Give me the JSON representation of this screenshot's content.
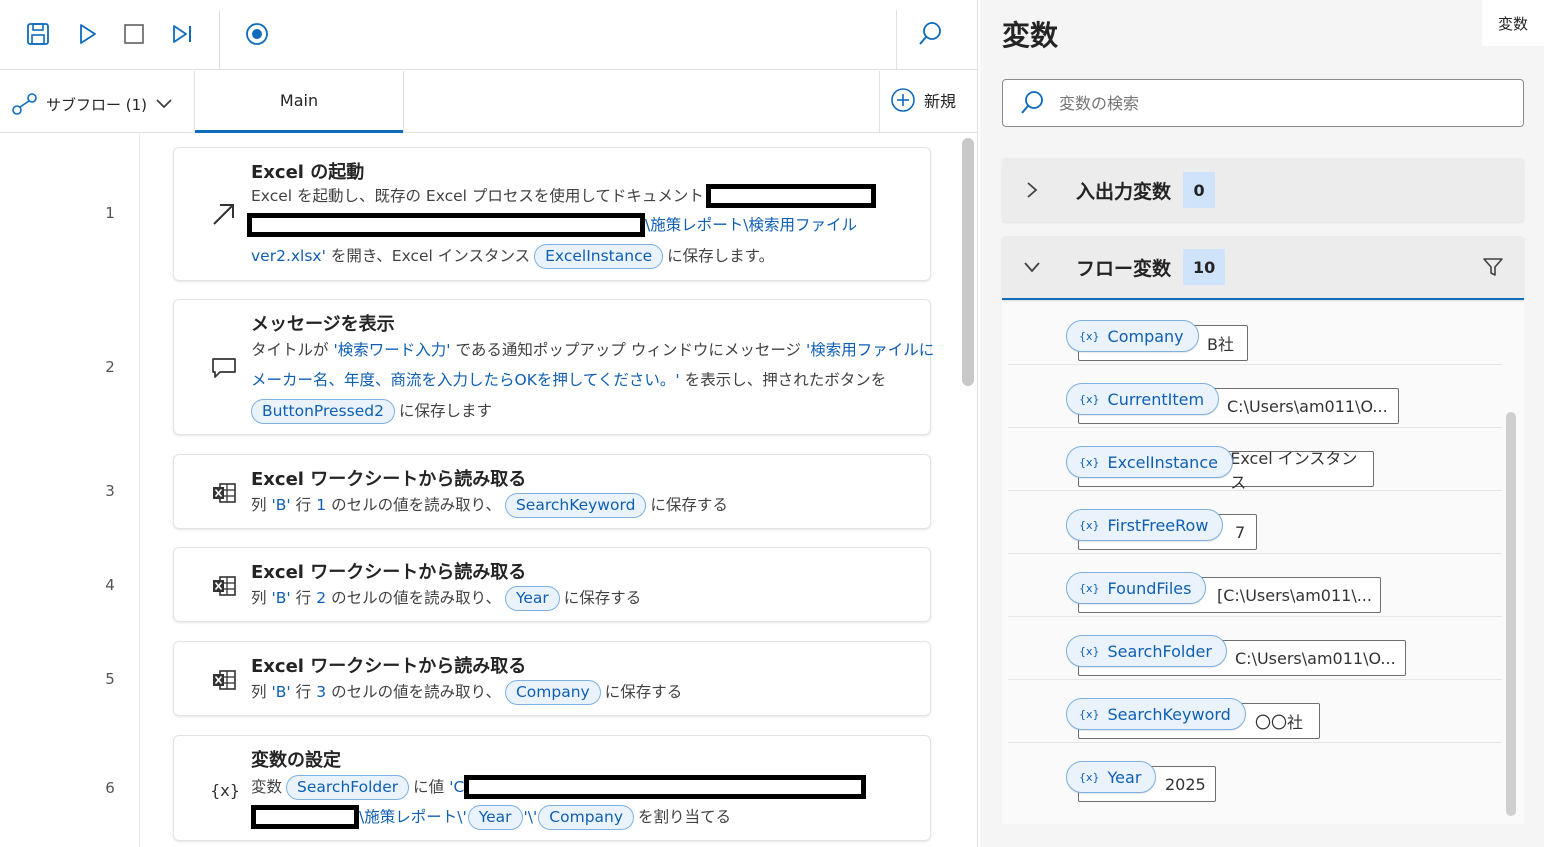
{
  "toolbar": {
    "icons": [
      "save-icon",
      "run-icon",
      "stop-icon",
      "step-icon",
      "record-icon",
      "search-icon"
    ]
  },
  "tabs": {
    "subflow_label": "サブフロー (1)",
    "main_label": "Main",
    "new_label": "新規"
  },
  "actions": [
    {
      "num": "1",
      "icon": "launch-arrow-icon",
      "title": "Excel の起動",
      "l1_text": "Excel を起動し、既存の Excel プロセスを使用してドキュメント",
      "l2_lit": "\\施策レポート\\検索用ファイル",
      "l3_lit": "ver2.xlsx'",
      "l3_text": "を開き、Excel インスタンス",
      "l3_chip": "ExcelInstance",
      "l3_tail": "に保存します。"
    },
    {
      "num": "2",
      "icon": "message-icon",
      "title": "メッセージを表示",
      "l1_pre": "タイトルが",
      "l1_lit1": "'検索ワード入力'",
      "l1_mid": "である通知ポップアップ ウィンドウにメッセージ",
      "l1_lit2": "'検索用ファイルに",
      "l2_lit": "メーカー名、年度、商流を入力したらOKを押してください。'",
      "l2_text": "を表示し、押されたボタンを",
      "l3_chip": "ButtonPressed2",
      "l3_tail": "に保存します"
    },
    {
      "num": "3",
      "icon": "excel-icon",
      "title": "Excel ワークシートから読み取る",
      "pre": "列",
      "col": "'B'",
      "rowword": "行",
      "row": "1",
      "mid": "のセルの値を読み取り、",
      "chip": "SearchKeyword",
      "tail": "に保存する"
    },
    {
      "num": "4",
      "icon": "excel-icon",
      "title": "Excel ワークシートから読み取る",
      "pre": "列",
      "col": "'B'",
      "rowword": "行",
      "row": "2",
      "mid": "のセルの値を読み取り、",
      "chip": "Year",
      "tail": "に保存する"
    },
    {
      "num": "5",
      "icon": "excel-icon",
      "title": "Excel ワークシートから読み取る",
      "pre": "列",
      "col": "'B'",
      "rowword": "行",
      "row": "3",
      "mid": "のセルの値を読み取り、",
      "chip": "Company",
      "tail": "に保存する"
    },
    {
      "num": "6",
      "icon": "variable-icon",
      "icon_text": "{x}",
      "title": "変数の設定",
      "l1_pre": "変数",
      "l1_chip": "SearchFolder",
      "l1_mid": "に値",
      "l1_lit": "'C",
      "l2_lit1": "\\施策レポート\\'",
      "l2_chip1": "Year",
      "l2_lit2": "'\\'",
      "l2_chip2": "Company",
      "l2_tail": "を割り当てる"
    }
  ],
  "variables_pane": {
    "title": "変数",
    "tab_label": "変数",
    "search_placeholder": "変数の検索",
    "io_section": {
      "title": "入出力変数",
      "count": "0"
    },
    "flow_section": {
      "title": "フロー変数",
      "count": "10"
    },
    "var_icon_text": "{x}",
    "items": [
      {
        "name": "Company",
        "value": "B社"
      },
      {
        "name": "CurrentItem",
        "value": "C:\\Users\\am011\\O..."
      },
      {
        "name": "ExcelInstance",
        "value": "Excel インスタンス"
      },
      {
        "name": "FirstFreeRow",
        "value": "7"
      },
      {
        "name": "FoundFiles",
        "value": "[C:\\Users\\am011\\..."
      },
      {
        "name": "SearchFolder",
        "value": "C:\\Users\\am011\\O..."
      },
      {
        "name": "SearchKeyword",
        "value": "〇〇社"
      },
      {
        "name": "Year",
        "value": "2025"
      }
    ]
  }
}
